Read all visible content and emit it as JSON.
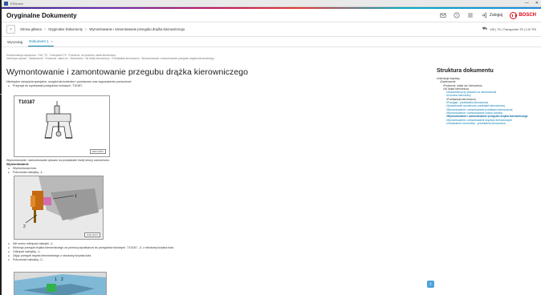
{
  "window": {
    "title": "ESItronic",
    "controls": [
      "—",
      "✕"
    ]
  },
  "header": {
    "title": "Oryginalne Dokumenty",
    "login_label": "Zaloguj",
    "brand": "BOSCH",
    "icons": [
      "mail-icon",
      "help-icon",
      "menu-icon",
      "login-icon"
    ]
  },
  "breadcrumb": {
    "back_label": "‹",
    "items": [
      "Strona główna",
      "Oryginalne Dokumenty",
      "Wymontowanie i zamontowanie przegubu drążka kierowniczego"
    ],
    "separator": ">",
    "vehicle": "VW | T5 | Transporter T5 | 2,0l TDI"
  },
  "tabs": {
    "items": [
      {
        "label": "Wyszukaj",
        "active": false
      },
      {
        "label": "Dokument 1",
        "active": true,
        "close": "×"
      }
    ]
  },
  "document": {
    "meta_line1": "Dokumentacja naprawcza · VW | T5 · Transporter T5 · Podwozie, oś przednia, układ kierowniczy",
    "meta_line2": "Instrukcje napraw · Zawieszenie · Podwozie, układ osi · Mechanizm · 48 Układ kierowniczy · Przekładnia kierownicza · Wymontowanie i zamontowanie przegubu drążka kierowniczego",
    "title": "Wymontowanie i zamontowanie przegubu drążka kierowniczego",
    "intro": "Niezbędne narzędzia specjalne, urządzenia kontrolne i pomiarowe oraz wyposażenie pomocnicze",
    "tool_bullet": "Przyrząd do wyciskania przegubów kulowych -T10187-",
    "fig1_label": "T10187",
    "fig1_code": "W00-11597",
    "remove_note": "Wymontowanie i zamontowanie opisano na przykładzie lewej strony samochodu.",
    "remove_head": "Wymontowanie",
    "remove_steps": [
      "Wymontować koło.",
      "Poluzować nakrętkę -1-."
    ],
    "fig2_code": "N48-10174",
    "fig2_callouts": [
      "1",
      "2"
    ],
    "after_steps": [
      "Nie wolno odkręcać nakrętki -1-.",
      "Wcisnąć przegub drążka kierowniczego za pomocą wyciskacza do przegubów kulowych -T10187- -2- z obudowy łożyska koła.",
      "Odkręcić nakrętkę -1-.",
      "Zdjąć przegub drążka kierowniczego z obudowy łożyska koła.",
      "Poluzować nakrętkę -2-."
    ],
    "fig3_callouts": [
      "1",
      "2"
    ]
  },
  "structure": {
    "title": "Struktura dokumentu",
    "items": [
      {
        "level": 0,
        "text": "Instrukcja naprawy",
        "kind": "plain"
      },
      {
        "level": 1,
        "text": "Zawieszenie",
        "kind": "plain"
      },
      {
        "level": 2,
        "text": "Podwozie, układ osi i kierownica",
        "kind": "plain"
      },
      {
        "level": 3,
        "text": "48 Układ kierowniczy",
        "kind": "plain"
      },
      {
        "level": 3,
        "text": "Wskazówki przy pracach na mechanizmie",
        "kind": "link"
      },
      {
        "level": 3,
        "text": "Kolumna kierownicy",
        "kind": "link"
      },
      {
        "level": 3,
        "text": "Przekładnia kierownicza",
        "kind": "plain"
      },
      {
        "level": 3,
        "text": "Przegląd - przekładnia kierownicza",
        "kind": "link"
      },
      {
        "level": 3,
        "text": "Sprawdzanie szczelności przekładni kierowniczej",
        "kind": "link"
      },
      {
        "level": 3,
        "text": "Wymontowanie i zamontowanie przekładni kierowniczej",
        "kind": "link"
      },
      {
        "level": 3,
        "text": "Wymontowanie i zamontowanie osłony łożyska",
        "kind": "link"
      },
      {
        "level": 3,
        "text": "Wymontowanie i zamontowanie przegubu drążka kierowniczego",
        "kind": "current"
      },
      {
        "level": 3,
        "text": "Wymontowanie i zamontowanie drążków kierowniczych",
        "kind": "link"
      },
      {
        "level": 3,
        "text": "Zestawienie momentów - przekładnia kierownicza",
        "kind": "link"
      }
    ]
  },
  "fab_label": "⇧",
  "colors": {
    "accent": "#0a7fb5",
    "brand_red": "#e20015"
  }
}
